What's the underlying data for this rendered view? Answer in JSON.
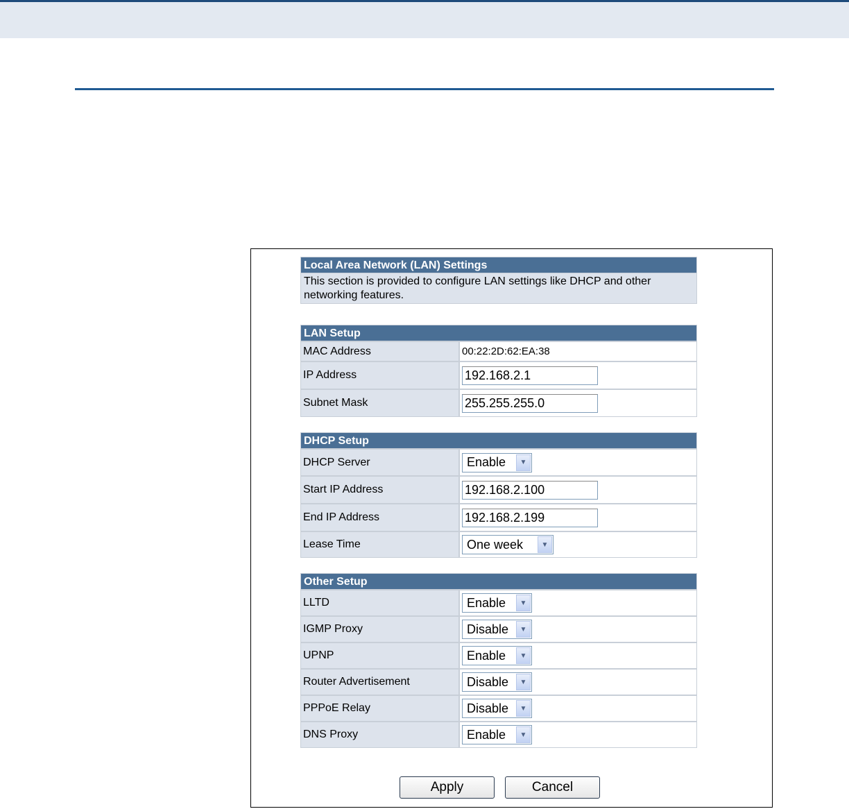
{
  "lan_intro": {
    "title": "Local Area Network (LAN) Settings",
    "description": "This section is provided to configure LAN settings like DHCP and other networking features."
  },
  "lan_setup": {
    "title": "LAN Setup",
    "mac_label": "MAC Address",
    "mac_value": "00:22:2D:62:EA:38",
    "ip_label": "IP Address",
    "ip_value": "192.168.2.1",
    "mask_label": "Subnet Mask",
    "mask_value": "255.255.255.0"
  },
  "dhcp_setup": {
    "title": "DHCP Setup",
    "server_label": "DHCP Server",
    "server_value": "Enable",
    "start_label": "Start IP Address",
    "start_value": "192.168.2.100",
    "end_label": "End IP Address",
    "end_value": "192.168.2.199",
    "lease_label": "Lease Time",
    "lease_value": "One week"
  },
  "other_setup": {
    "title": "Other Setup",
    "rows": [
      {
        "label": "LLTD",
        "value": "Enable"
      },
      {
        "label": "IGMP Proxy",
        "value": "Disable"
      },
      {
        "label": "UPNP",
        "value": "Enable"
      },
      {
        "label": "Router Advertisement",
        "value": "Disable"
      },
      {
        "label": "PPPoE Relay",
        "value": "Disable"
      },
      {
        "label": "DNS Proxy",
        "value": "Enable"
      }
    ]
  },
  "buttons": {
    "apply": "Apply",
    "cancel": "Cancel"
  }
}
